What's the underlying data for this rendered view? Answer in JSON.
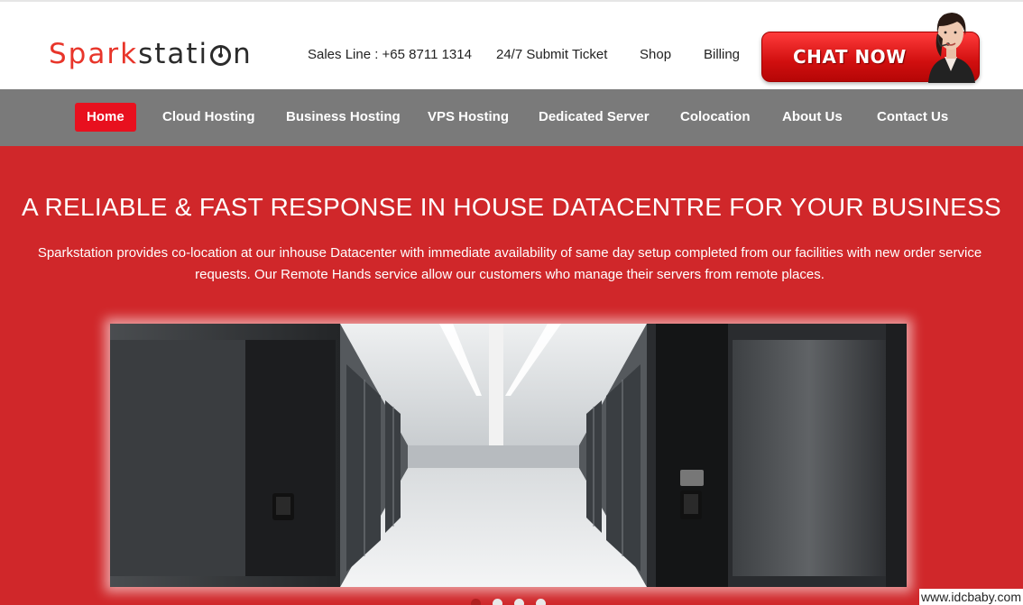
{
  "brand": {
    "part1": "Spark",
    "part2": "stati",
    "part3": "n"
  },
  "toplinks": {
    "sales": "Sales Line : +65 8711 1314",
    "ticket": "24/7 Submit Ticket",
    "shop": "Shop",
    "billing": "Billing"
  },
  "chat": {
    "label": "CHAT NOW"
  },
  "nav": [
    {
      "label": "Home"
    },
    {
      "label": "Cloud Hosting"
    },
    {
      "label": "Business Hosting"
    },
    {
      "label": "VPS Hosting"
    },
    {
      "label": "Dedicated Server"
    },
    {
      "label": "Colocation"
    },
    {
      "label": "About Us"
    },
    {
      "label": "Contact Us"
    }
  ],
  "hero": {
    "title": "A RELIABLE & FAST RESPONSE IN HOUSE DATACENTRE FOR YOUR BUSINESS",
    "description": "Sparkstation provides co-location at our inhouse Datacenter with immediate availability of same day setup completed from our facilities with new order service requests. Our Remote Hands service allow our customers who manage their servers from remote places."
  },
  "watermark": "www.idcbaby.com",
  "colors": {
    "accent": "#d0272a",
    "nav_active": "#e8101e",
    "nav_bg": "#7a7a7a"
  }
}
